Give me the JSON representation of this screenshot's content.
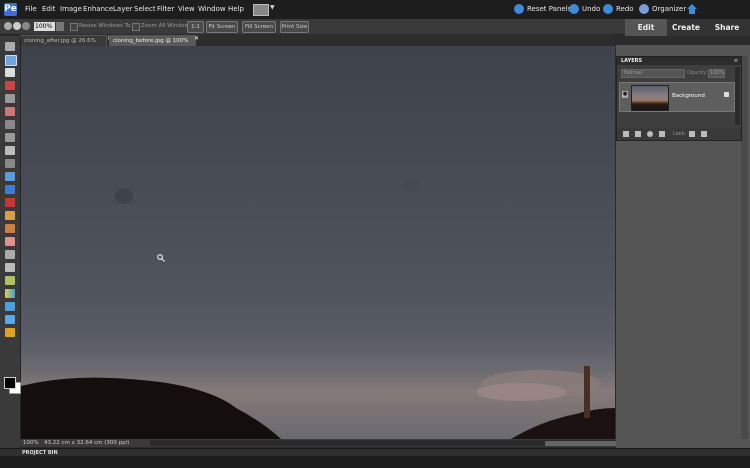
{
  "menubar": {
    "app_icon": "Pe",
    "items": [
      "File",
      "Edit",
      "Image",
      "Enhance",
      "Layer",
      "Select",
      "Filter",
      "View",
      "Window",
      "Help"
    ],
    "reset_panels": "Reset Panels",
    "undo": "Undo",
    "redo": "Redo",
    "organizer": "Organizer"
  },
  "options": {
    "zoom_value": "100%",
    "resize_windows": "Resize Windows To Fit",
    "zoom_all_windows": "Zoom All Windows",
    "btn_1to1": "1:1",
    "btn_fit_screen": "Fit Screen",
    "btn_fill_screen": "Fill Screen",
    "btn_print_size": "Print Size"
  },
  "modes": {
    "edit": "Edit",
    "create": "Create",
    "share": "Share"
  },
  "tabs": [
    {
      "label": "cloning_after.jpg @ 26.6% (RGB/8)"
    },
    {
      "label": "cloning_before.jpg @ 100%(RGB/8) *"
    }
  ],
  "status": {
    "zoom": "100%",
    "doc_size": "43.22 cm x 32.64 cm (300 ppi)"
  },
  "project_bin": "PROJECT BIN",
  "layers": {
    "title": "LAYERS",
    "blend_mode": "Normal",
    "opacity_label": "Opacity:",
    "opacity_value": "100%",
    "layer_name": "Background",
    "lock_label": "Lock:"
  },
  "icons": {
    "reset_color": "#3d8ad8",
    "undo_color": "#3d8ad8",
    "redo_color": "#3d8ad8",
    "organizer_color": "#7a9dd8"
  }
}
